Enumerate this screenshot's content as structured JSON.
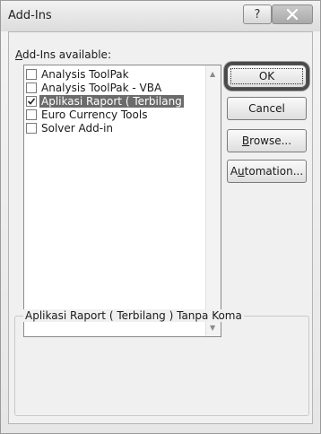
{
  "window": {
    "title": "Add-Ins",
    "help_glyph": "?"
  },
  "addins": {
    "label_accel": "A",
    "label_rest": "dd-Ins available:",
    "items": [
      {
        "label": "Analysis ToolPak",
        "checked": false
      },
      {
        "label": "Analysis ToolPak - VBA",
        "checked": false
      },
      {
        "label": "Aplikasi Raport ( Terbilang",
        "checked": true
      },
      {
        "label": "Euro Currency Tools",
        "checked": false
      },
      {
        "label": "Solver Add-in",
        "checked": false
      }
    ],
    "selected_index": 2
  },
  "buttons": {
    "ok": "OK",
    "cancel": "Cancel",
    "browse_accel": "B",
    "browse_rest": "rowse...",
    "automation_pre": "A",
    "automation_accel": "u",
    "automation_rest": "tomation..."
  },
  "description": {
    "title": "Aplikasi Raport ( Terbilang ) Tanpa Koma"
  },
  "colors": {
    "selection": "#6b6b6b"
  }
}
